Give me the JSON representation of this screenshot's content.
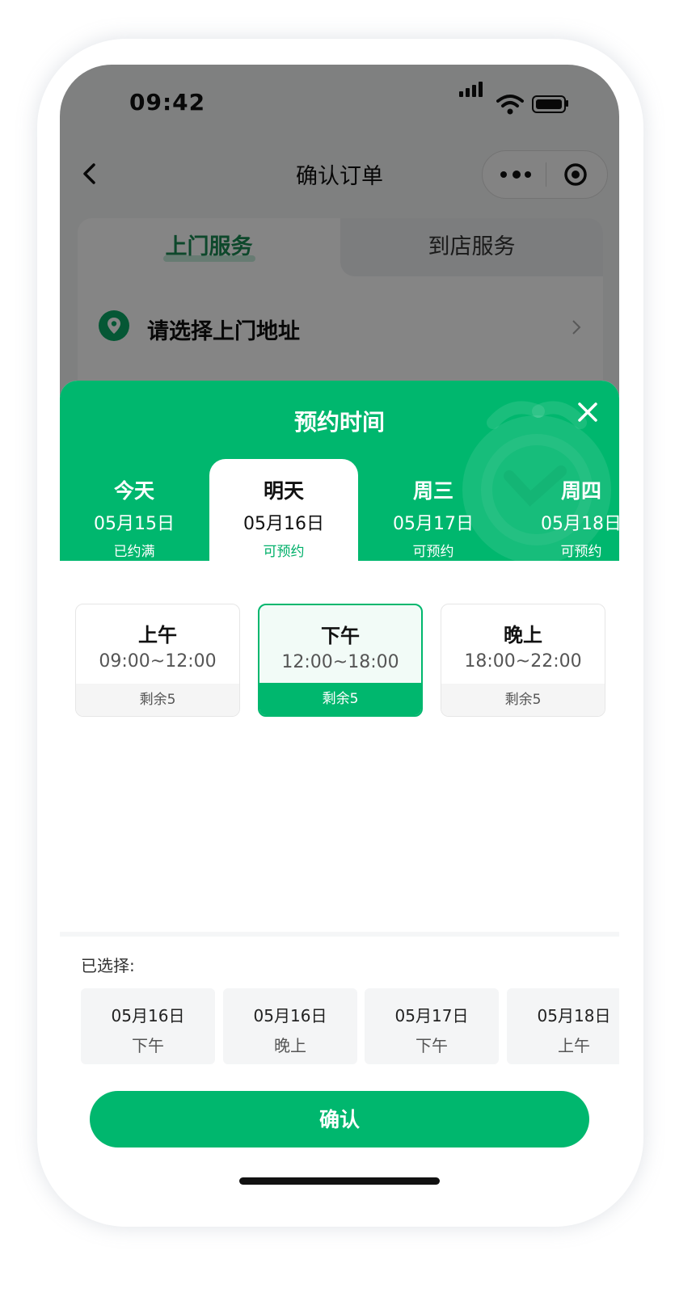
{
  "status_bar": {
    "time": "09:42"
  },
  "nav": {
    "title": "确认订单"
  },
  "service_tabs": {
    "home_service": "上门服务",
    "store_service": "到店服务"
  },
  "address": {
    "placeholder": "请选择上门地址"
  },
  "sheet": {
    "title": "预约时间",
    "dates": [
      {
        "day": "今天",
        "date": "05月15日",
        "status": "已约满"
      },
      {
        "day": "明天",
        "date": "05月16日",
        "status": "可预约"
      },
      {
        "day": "周三",
        "date": "05月17日",
        "status": "可预约"
      },
      {
        "day": "周四",
        "date": "05月18日",
        "status": "可预约"
      }
    ],
    "active_date_index": 1,
    "slots": [
      {
        "name": "上午",
        "range": "09:00~12:00",
        "remain": "剩余5"
      },
      {
        "name": "下午",
        "range": "12:00~18:00",
        "remain": "剩余5"
      },
      {
        "name": "晚上",
        "range": "18:00~22:00",
        "remain": "剩余5"
      }
    ],
    "active_slot_index": 1,
    "selected_label": "已选择:",
    "selected": [
      {
        "date": "05月16日",
        "period": "下午"
      },
      {
        "date": "05月16日",
        "period": "晚上"
      },
      {
        "date": "05月17日",
        "period": "下午"
      },
      {
        "date": "05月18日",
        "period": "上午"
      }
    ],
    "confirm_label": "确认"
  },
  "colors": {
    "accent": "#00b76e",
    "overlay": "rgba(0,0,0,0.48)"
  },
  "icons": [
    "back-icon",
    "more-dots-icon",
    "target-icon",
    "location-pin-icon",
    "chevron-right-icon",
    "close-icon",
    "clock-decoration-icon",
    "signal-icon",
    "wifi-icon",
    "battery-icon"
  ]
}
